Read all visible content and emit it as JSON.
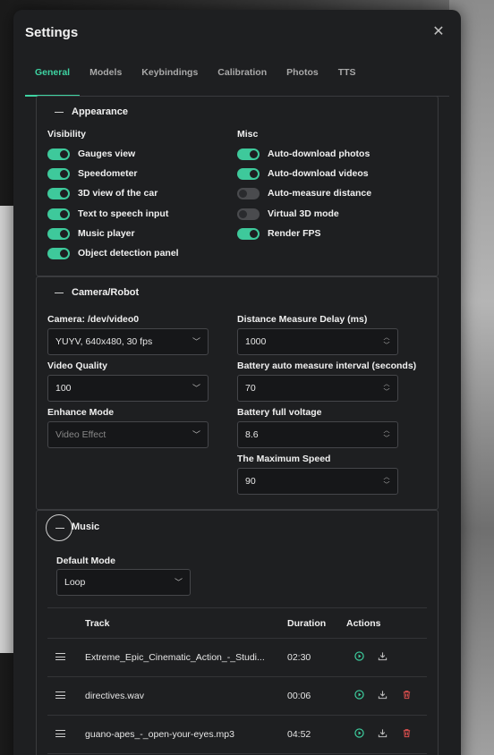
{
  "dialog": {
    "title": "Settings",
    "close_icon": "close-icon"
  },
  "tabs": [
    {
      "label": "General",
      "active": true
    },
    {
      "label": "Models"
    },
    {
      "label": "Keybindings"
    },
    {
      "label": "Calibration"
    },
    {
      "label": "Photos"
    },
    {
      "label": "TTS"
    }
  ],
  "appearance": {
    "title": "Appearance",
    "visibility": {
      "title": "Visibility",
      "items": [
        {
          "label": "Gauges view",
          "on": true
        },
        {
          "label": "Speedometer",
          "on": true
        },
        {
          "label": "3D view of the car",
          "on": true
        },
        {
          "label": "Text to speech input",
          "on": true
        },
        {
          "label": "Music player",
          "on": true
        },
        {
          "label": "Object detection panel",
          "on": true
        }
      ]
    },
    "misc": {
      "title": "Misc",
      "items": [
        {
          "label": "Auto-download photos",
          "on": true
        },
        {
          "label": "Auto-download videos",
          "on": true
        },
        {
          "label": "Auto-measure distance",
          "on": false
        },
        {
          "label": "Virtual 3D mode",
          "on": false
        },
        {
          "label": "Render FPS",
          "on": true
        }
      ]
    }
  },
  "camera": {
    "title": "Camera/Robot",
    "camera_label": "Camera: /dev/video0",
    "camera_value": "YUYV, 640x480, 30 fps",
    "quality_label": "Video Quality",
    "quality_value": "100",
    "enhance_label": "Enhance Mode",
    "enhance_placeholder": "Video Effect",
    "delay_label": "Distance Measure Delay (ms)",
    "delay_value": "1000",
    "battery_interval_label": "Battery auto measure interval (seconds)",
    "battery_interval_value": "70",
    "battery_voltage_label": "Battery full voltage",
    "battery_voltage_value": "8.6",
    "max_speed_label": "The Maximum Speed",
    "max_speed_value": "90"
  },
  "music": {
    "title": "Music",
    "mode_label": "Default Mode",
    "mode_value": "Loop",
    "columns": {
      "track": "Track",
      "duration": "Duration",
      "actions": "Actions"
    },
    "tracks": [
      {
        "name": "Extreme_Epic_Cinematic_Action_-_Studi...",
        "duration": "02:30",
        "deletable": false
      },
      {
        "name": "directives.wav",
        "duration": "00:06",
        "deletable": true
      },
      {
        "name": "guano-apes_-_open-your-eyes.mp3",
        "duration": "04:52",
        "deletable": true
      }
    ]
  },
  "colors": {
    "accent": "#3ed3a2",
    "toggle_on": "#3ec99b",
    "delete": "#e0504f",
    "panel_bg": "#1e1f21"
  }
}
